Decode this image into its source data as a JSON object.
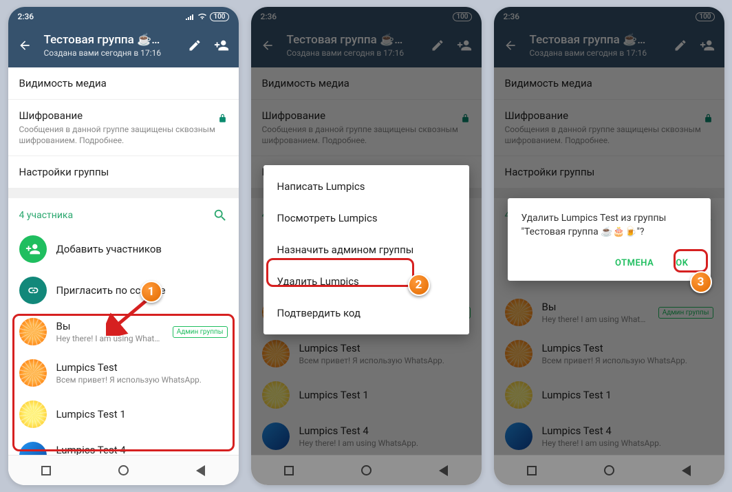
{
  "status": {
    "time": "2:36",
    "battery": "100"
  },
  "header": {
    "title": "Тестовая группа ☕…",
    "subtitle": "Создана вами сегодня в 17:16"
  },
  "settings": {
    "media_visibility": "Видимость медиа",
    "encryption_title": "Шифрование",
    "encryption_desc": "Сообщения в данной группе защищены сквозным шифрованием. Подробнее.",
    "group_settings": "Настройки группы"
  },
  "participants": {
    "count_label": "4 участника",
    "add": "Добавить участников",
    "invite": "Пригласить по ссылке",
    "admin_badge": "Админ группы",
    "list": [
      {
        "name": "Вы",
        "status": "Hey there! I am using WhatsApp."
      },
      {
        "name": "Lumpics Test",
        "status": "Всем привет! Я использую WhatsApp."
      },
      {
        "name": "Lumpics Test 1",
        "status": ""
      },
      {
        "name": "Lumpics Test 4",
        "status": "Hey there! I am using WhatsApp."
      }
    ]
  },
  "context_menu": {
    "items": [
      "Написать Lumpics",
      "Посмотреть Lumpics",
      "Назначить админом группы",
      "Удалить Lumpics",
      "Подтвердить код"
    ]
  },
  "dialog": {
    "text": "Удалить Lumpics Test из группы \"Тестовая группа ☕🎂🍺\"?",
    "cancel": "ОТМЕНА",
    "ok": "OK"
  },
  "annotations": {
    "step1": "1",
    "step2": "2",
    "step3": "3"
  }
}
